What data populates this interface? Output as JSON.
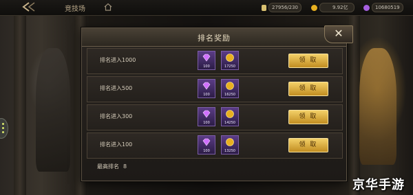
{
  "topbar": {
    "title": "竞技场",
    "stamina": "27956/230",
    "gold": "9.92亿",
    "gems": "10680519"
  },
  "dialog": {
    "title": "排名奖励",
    "close_icon": "close-icon",
    "rows": [
      {
        "label": "排名进入1000",
        "gem_qty": "100",
        "coin_qty": "17250",
        "button": "领 取"
      },
      {
        "label": "排名进入500",
        "gem_qty": "100",
        "coin_qty": "16250",
        "button": "领 取"
      },
      {
        "label": "排名进入300",
        "gem_qty": "100",
        "coin_qty": "14250",
        "button": "领 取"
      },
      {
        "label": "排名进入100",
        "gem_qty": "100",
        "coin_qty": "13250",
        "button": "领 取"
      }
    ],
    "best_rank_label": "最高排名",
    "best_rank_value": "8"
  },
  "watermark": "京华手游",
  "colors": {
    "button_gold": "#e0b040",
    "item_purple": "#5b3c86",
    "coin_gold": "#e8b020"
  }
}
